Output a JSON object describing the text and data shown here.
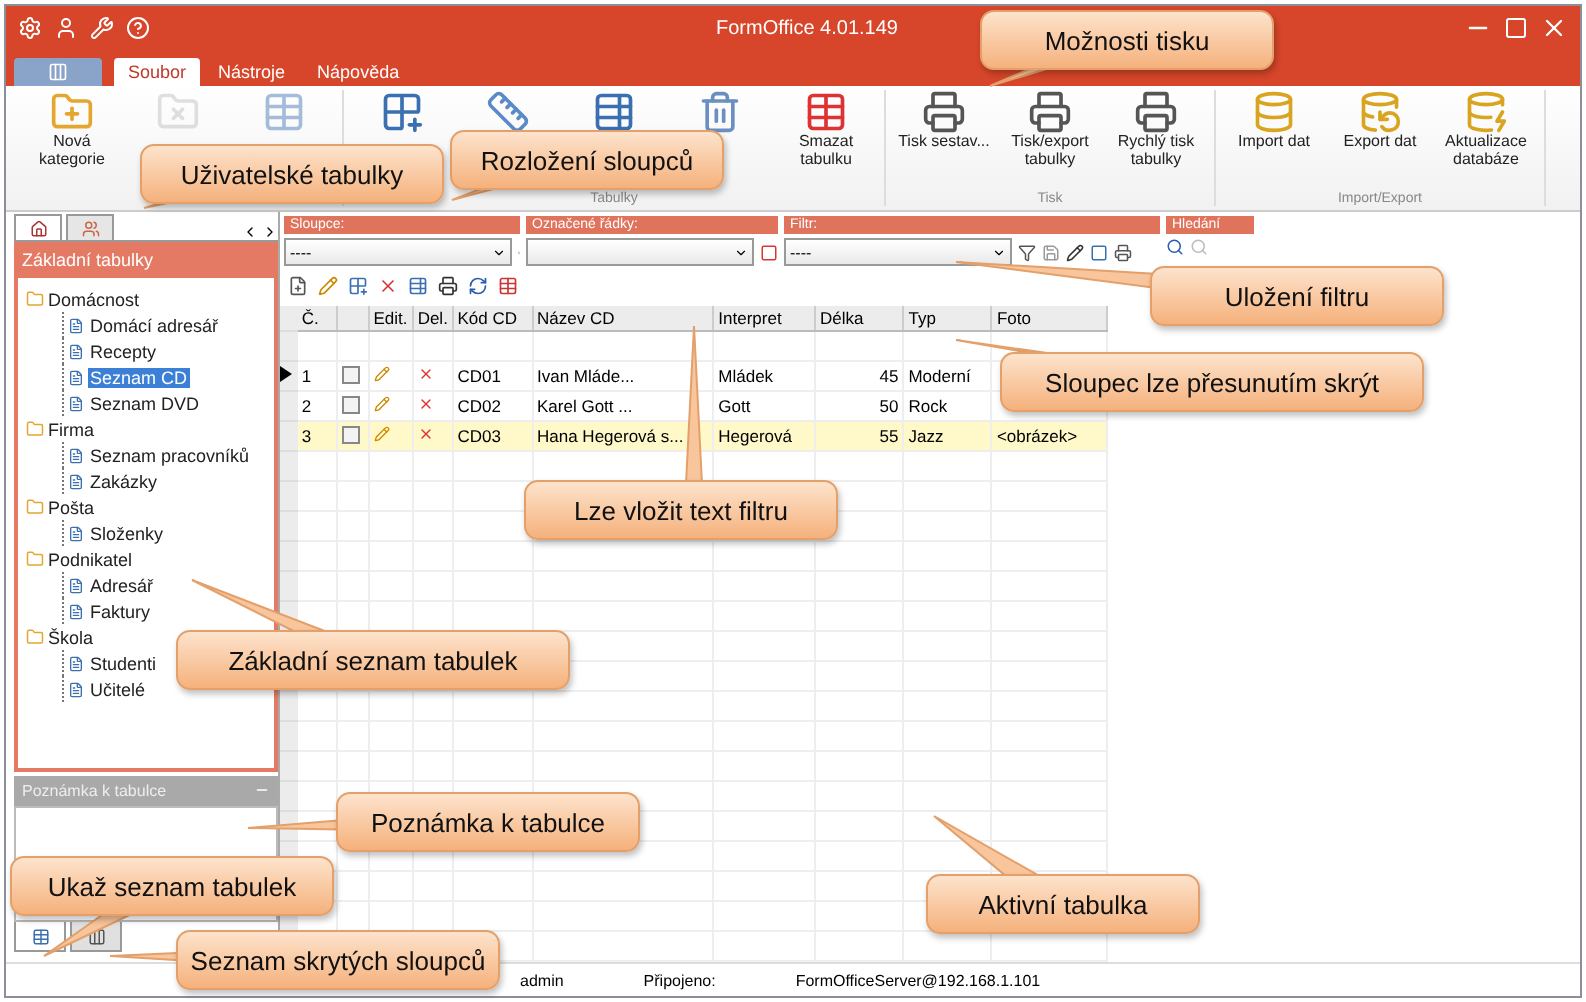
{
  "window": {
    "title": "FormOffice 4.01.149"
  },
  "ribbon_tabs": [
    {
      "label": "Soubor",
      "selected": true
    },
    {
      "label": "Nástroje",
      "selected": false
    },
    {
      "label": "Nápověda",
      "selected": false
    }
  ],
  "ribbon_groups": [
    {
      "buttons": [
        {
          "label": "Nová kategorie",
          "disabled": false
        },
        {
          "disabled": true
        },
        {
          "disabled": true
        }
      ]
    },
    {
      "label": "Tabulky",
      "buttons": [
        {
          "disabled": false
        },
        {
          "disabled": false
        },
        {
          "disabled": false
        },
        {
          "disabled": false
        },
        {
          "label": "Smazat tabulku",
          "disabled": false
        }
      ]
    },
    {
      "label": "Tisk",
      "buttons": [
        {
          "label": "Tisk sestav...",
          "disabled": false
        },
        {
          "label": "Tisk/export tabulky",
          "disabled": false
        },
        {
          "label": "Rychlý tisk tabulky",
          "disabled": false
        }
      ]
    },
    {
      "label": "Import/Export",
      "buttons": [
        {
          "label": "Import dat",
          "disabled": false
        },
        {
          "label": "Export dat",
          "disabled": false
        },
        {
          "label": "Aktualizace databáze",
          "disabled": false
        }
      ]
    }
  ],
  "filter_bar": {
    "sections": [
      {
        "label": "Sloupce:",
        "value": "----"
      },
      {
        "label": "Označené řádky:"
      },
      {
        "label": "Filtr:",
        "value": "----"
      },
      {
        "label": "Hledání"
      }
    ]
  },
  "left_panel": {
    "tabs": [
      {
        "selected": true
      },
      {
        "selected": false
      }
    ],
    "header": "Základní tabulky",
    "tree": [
      {
        "label": "Domácnost",
        "children": [
          {
            "label": "Domácí adresář",
            "selected": false
          },
          {
            "label": "Recepty",
            "selected": false
          },
          {
            "label": "Seznam CD",
            "selected": true
          },
          {
            "label": "Seznam DVD",
            "selected": false
          }
        ]
      },
      {
        "label": "Firma",
        "children": [
          {
            "label": "Seznam pracovníků",
            "selected": false
          },
          {
            "label": "Zakázky",
            "selected": false
          }
        ]
      },
      {
        "label": "Pošta",
        "children": [
          {
            "label": "Složenky",
            "selected": false
          }
        ]
      },
      {
        "label": "Podnikatel",
        "children": [
          {
            "label": "Adresář",
            "selected": false
          },
          {
            "label": "Faktury",
            "selected": false
          }
        ]
      },
      {
        "label": "Škola",
        "children": [
          {
            "label": "Studenti",
            "selected": false
          },
          {
            "label": "Učitelé",
            "selected": false
          }
        ]
      }
    ],
    "note_header": "Poznámka k tabulce",
    "bottom_tabs": [
      {
        "selected": true
      },
      {
        "selected": false
      }
    ]
  },
  "grid": {
    "columns": [
      "Č.",
      "",
      "Edit.",
      "Del.",
      "Kód CD",
      "Název CD",
      "Interpret",
      "Délka",
      "Typ",
      "Foto"
    ],
    "rows": [
      {
        "number": "1",
        "checked": false,
        "code": "CD01",
        "name": "Ivan Mláde...",
        "artist": "Mládek",
        "length": "45",
        "type": "Moderní",
        "current": true,
        "selected": false
      },
      {
        "number": "2",
        "checked": false,
        "code": "CD02",
        "name": "Karel Gott ...",
        "artist": "Gott",
        "length": "50",
        "type": "Rock",
        "current": false,
        "selected": false
      },
      {
        "number": "3",
        "checked": false,
        "code": "CD03",
        "name": "Hana Hegerová s...",
        "artist": "Hegerová",
        "length": "55",
        "type": "Jazz",
        "photo": "<obrázek>",
        "current": false,
        "selected": true
      }
    ]
  },
  "status_bar": [
    {
      "text": "admin"
    },
    {
      "text": "Připojeno:"
    },
    {
      "text": "FormOfficeServer@192.168.1.101"
    }
  ],
  "callouts": [
    "Možnosti tisku",
    "Rozložení sloupců",
    "Uživatelské tabulky",
    "Uložení filtru",
    "Sloupec lze přesunutím skrýt",
    "Lze vložit text filtru",
    "Základní seznam tabulek",
    "Poznámka k tabulce",
    "Ukaž seznam tabulek",
    "Seznam skrytých sloupců",
    "Aktivní tabulka"
  ]
}
